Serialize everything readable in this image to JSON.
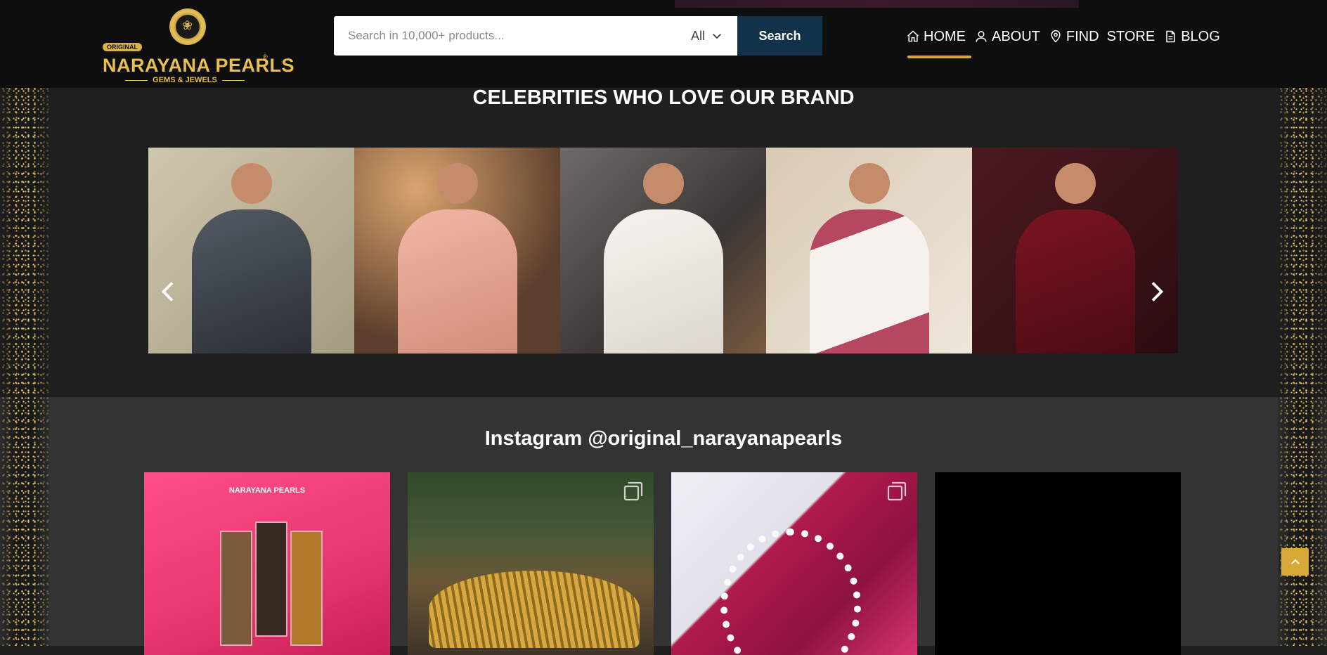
{
  "header": {
    "logo": {
      "tag": "ORIGINAL",
      "brand": "NARAYANA PEARLS",
      "registered": "®",
      "tagline": "GEMS & JEWELS"
    },
    "search": {
      "placeholder": "Search in 10,000+ products...",
      "value": "",
      "category": "All",
      "button_label": "Search"
    },
    "nav": [
      {
        "label": "HOME",
        "icon": "home-icon",
        "active": true
      },
      {
        "label": "ABOUT",
        "icon": "user-icon",
        "active": false
      },
      {
        "label": "FIND  STORE",
        "icon": "map-pin-icon",
        "active": false
      },
      {
        "label": "BLOG",
        "icon": "document-icon",
        "active": false
      }
    ]
  },
  "celebrities": {
    "title": "CELEBRITIES WHO LOVE OUR BRAND",
    "slides": [
      "celebrity-1",
      "celebrity-2",
      "celebrity-3",
      "celebrity-4",
      "celebrity-5"
    ]
  },
  "instagram": {
    "title": "Instagram @original_narayanapearls",
    "tiles": [
      {
        "multi": false,
        "overlay_text": "NARAYANA PEARLS"
      },
      {
        "multi": true
      },
      {
        "multi": true
      },
      {
        "multi": false
      }
    ]
  },
  "colors": {
    "accent_gold": "#d9a33d",
    "search_button": "#113248",
    "header_bg": "#0e0e0e"
  }
}
